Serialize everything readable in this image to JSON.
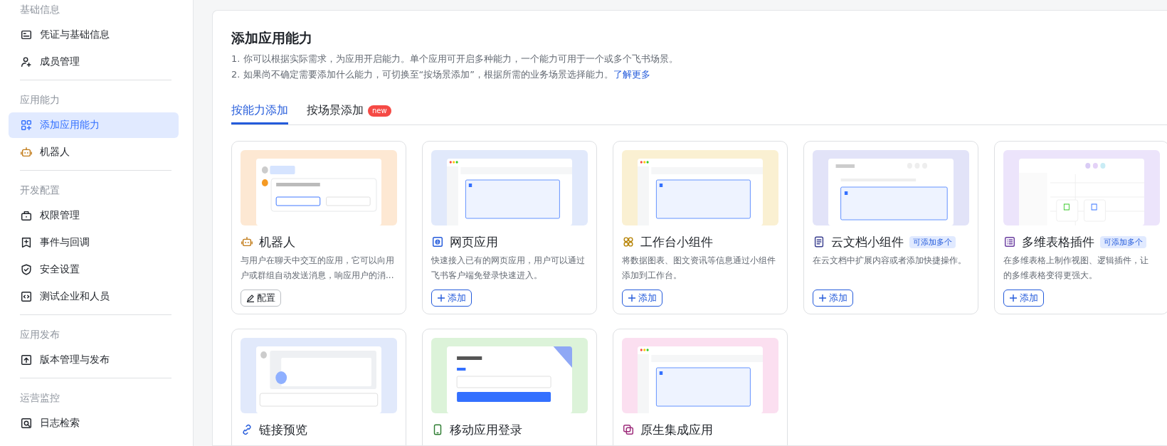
{
  "sidebar": {
    "sections": [
      {
        "title": "基础信息",
        "items": [
          {
            "label": "凭证与基础信息",
            "selected": false
          },
          {
            "label": "成员管理",
            "selected": false
          }
        ]
      },
      {
        "title": "应用能力",
        "items": [
          {
            "label": "添加应用能力",
            "selected": true
          },
          {
            "label": "机器人",
            "selected": false
          }
        ]
      },
      {
        "title": "开发配置",
        "items": [
          {
            "label": "权限管理",
            "selected": false
          },
          {
            "label": "事件与回调",
            "selected": false
          },
          {
            "label": "安全设置",
            "selected": false
          },
          {
            "label": "测试企业和人员",
            "selected": false
          }
        ]
      },
      {
        "title": "应用发布",
        "items": [
          {
            "label": "版本管理与发布",
            "selected": false
          }
        ]
      },
      {
        "title": "运营监控",
        "items": [
          {
            "label": "日志检索",
            "selected": false
          }
        ]
      }
    ]
  },
  "main": {
    "title": "添加应用能力",
    "notes": [
      {
        "text": "1. 你可以根据实际需求，为应用开启能力。单个应用可开启多种能力，一个能力可用于一个或多个飞书场景。"
      },
      {
        "text": "2. 如果尚不确定需要添加什么能力，可切换至“按场景添加”，根据所需的业务场景选择能力。",
        "link": "了解更多"
      }
    ],
    "tabs": [
      {
        "label": "按能力添加",
        "selected": true
      },
      {
        "label": "按场景添加",
        "selected": false,
        "badge": "new"
      }
    ],
    "cards": [
      {
        "title": "机器人",
        "color": "#fde8d3",
        "description": [
          "与用户在聊天中交互的应用，它可以向用",
          "户或群组自动发送消息，响应用户的消..."
        ],
        "button": {
          "kind": "configure",
          "label": "配置"
        }
      },
      {
        "title": "网页应用",
        "color": "#e1e9fb",
        "description": [
          "快速接入已有的网页应用，用户可以通过",
          "飞书客户端免登录快速进入。"
        ],
        "button": {
          "kind": "add",
          "label": "添加"
        }
      },
      {
        "title": "工作台小组件",
        "color": "#faf0d2",
        "description": [
          "将数据图表、图文资讯等信息通过小组件",
          "添加到工作台。"
        ],
        "button": {
          "kind": "add",
          "label": "添加"
        }
      },
      {
        "title": "云文档小组件",
        "badge": "可添加多个",
        "color": "#e2e3f8",
        "description": [
          "在云文档中扩展内容或者添加快捷操作。"
        ],
        "button": {
          "kind": "add",
          "label": "添加"
        }
      },
      {
        "title": "多维表格插件",
        "badge": "可添加多个",
        "color": "#ece4fb",
        "description": [
          "在多维表格上制作视图、逻辑插件，让",
          "的多维表格变得更强大。"
        ],
        "button": {
          "kind": "add",
          "label": "添加"
        }
      },
      {
        "title": "链接预览",
        "color": "#e1e9fb"
      },
      {
        "title": "移动应用登录",
        "color": "#dcf3d9"
      },
      {
        "title": "原生集成应用",
        "color": "#fbdff0"
      }
    ]
  }
}
